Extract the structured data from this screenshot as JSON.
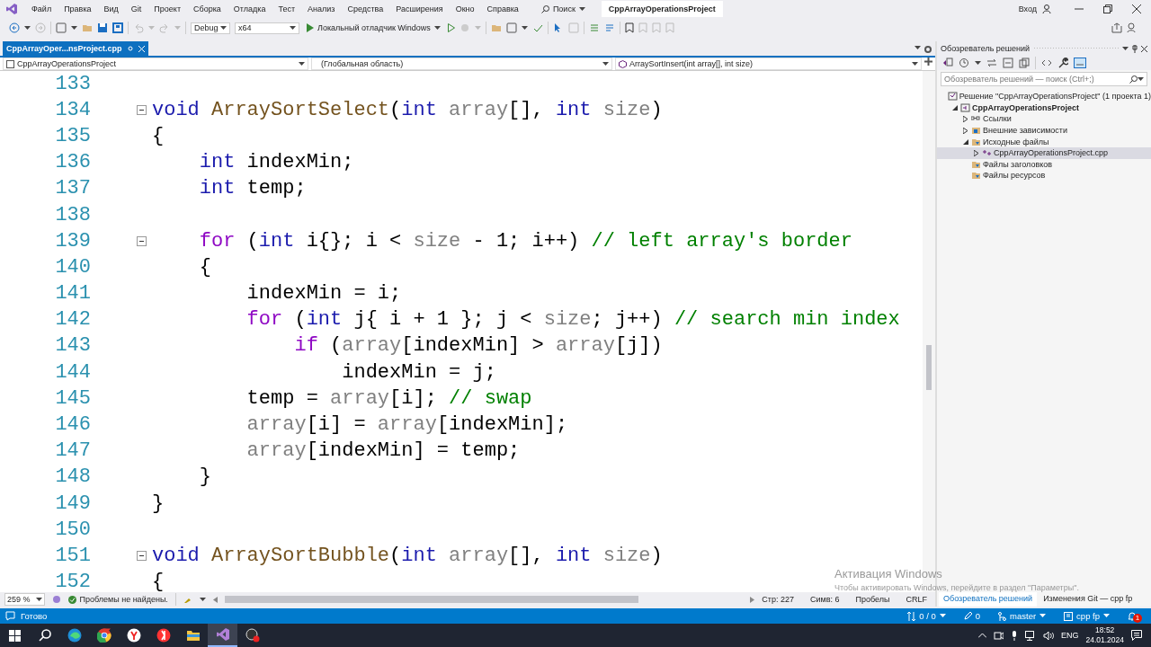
{
  "title_bar": {
    "menu": [
      "Файл",
      "Правка",
      "Вид",
      "Git",
      "Проект",
      "Сборка",
      "Отладка",
      "Тест",
      "Анализ",
      "Средства",
      "Расширения",
      "Окно",
      "Справка"
    ],
    "search": "Поиск",
    "solution_name": "CppArrayOperationsProject",
    "sign_in": "Вход"
  },
  "toolbar": {
    "configuration": "Debug",
    "platform": "x64",
    "run_target": "Локальный отладчик Windows"
  },
  "editor": {
    "tabs": [
      {
        "label": "CppArrayOper...nsProject.cpp",
        "selected": true
      }
    ],
    "nav": {
      "project": "CppArrayOperationsProject",
      "scope": "(Глобальная область)",
      "member": "ArraySortInsert(int array[], int size)"
    },
    "lines": [
      {
        "n": "133"
      },
      {
        "n": "134",
        "expanded": true,
        "spans": [
          {
            "text": "void ",
            "color": "#1b1bad"
          },
          {
            "text": "ArraySortSelect",
            "color": "#74531f"
          },
          {
            "text": "(",
            "color": "#000000"
          },
          {
            "text": "int ",
            "color": "#1b1bad"
          },
          {
            "text": "array",
            "color": "#808080"
          },
          {
            "text": "[], ",
            "color": "#000000"
          },
          {
            "text": "int ",
            "color": "#1b1bad"
          },
          {
            "text": "size",
            "color": "#808080"
          },
          {
            "text": ")",
            "color": "#000000"
          }
        ]
      },
      {
        "n": "135",
        "spans": [
          {
            "text": "{",
            "color": "#000000"
          }
        ]
      },
      {
        "n": "136",
        "spans": [
          {
            "text": "    int",
            "color": "#1b1bad"
          },
          {
            "text": " indexMin;",
            "color": "#000000"
          }
        ]
      },
      {
        "n": "137",
        "spans": [
          {
            "text": "    int",
            "color": "#1b1bad"
          },
          {
            "text": " temp;",
            "color": "#000000"
          }
        ]
      },
      {
        "n": "138"
      },
      {
        "n": "139",
        "expanded": true,
        "spans": [
          {
            "text": "    for",
            "color": "#8f08c4"
          },
          {
            "text": " (",
            "color": "#000000"
          },
          {
            "text": "int",
            "color": "#1b1bad"
          },
          {
            "text": " i{}; i < ",
            "color": "#000000"
          },
          {
            "text": "size",
            "color": "#808080"
          },
          {
            "text": " - 1; i++) ",
            "color": "#000000"
          },
          {
            "text": "// left array's border",
            "color": "#008000"
          }
        ]
      },
      {
        "n": "140",
        "spans": [
          {
            "text": "    {",
            "color": "#000000"
          }
        ]
      },
      {
        "n": "141",
        "spans": [
          {
            "text": "        indexMin = i;",
            "color": "#000000"
          }
        ]
      },
      {
        "n": "142",
        "spans": [
          {
            "text": "        for",
            "color": "#8f08c4"
          },
          {
            "text": " (",
            "color": "#000000"
          },
          {
            "text": "int",
            "color": "#1b1bad"
          },
          {
            "text": " j{ i + 1 }; j < ",
            "color": "#000000"
          },
          {
            "text": "size",
            "color": "#808080"
          },
          {
            "text": "; j++) ",
            "color": "#000000"
          },
          {
            "text": "// search min index",
            "color": "#008000"
          }
        ]
      },
      {
        "n": "143",
        "spans": [
          {
            "text": "            if",
            "color": "#8f08c4"
          },
          {
            "text": " (",
            "color": "#000000"
          },
          {
            "text": "array",
            "color": "#808080"
          },
          {
            "text": "[indexMin] > ",
            "color": "#000000"
          },
          {
            "text": "array",
            "color": "#808080"
          },
          {
            "text": "[j])",
            "color": "#000000"
          }
        ]
      },
      {
        "n": "144",
        "spans": [
          {
            "text": "                indexMin = j;",
            "color": "#000000"
          }
        ]
      },
      {
        "n": "145",
        "spans": [
          {
            "text": "        temp = ",
            "color": "#000000"
          },
          {
            "text": "array",
            "color": "#808080"
          },
          {
            "text": "[i]; ",
            "color": "#000000"
          },
          {
            "text": "// swap",
            "color": "#008000"
          }
        ]
      },
      {
        "n": "146",
        "spans": [
          {
            "text": "        array",
            "color": "#808080"
          },
          {
            "text": "[i] = ",
            "color": "#000000"
          },
          {
            "text": "array",
            "color": "#808080"
          },
          {
            "text": "[indexMin];",
            "color": "#000000"
          }
        ]
      },
      {
        "n": "147",
        "spans": [
          {
            "text": "        array",
            "color": "#808080"
          },
          {
            "text": "[indexMin] = temp;",
            "color": "#000000"
          }
        ]
      },
      {
        "n": "148",
        "spans": [
          {
            "text": "    }",
            "color": "#000000"
          }
        ]
      },
      {
        "n": "149",
        "spans": [
          {
            "text": "}",
            "color": "#000000"
          }
        ]
      },
      {
        "n": "150"
      },
      {
        "n": "151",
        "expanded": true,
        "spans": [
          {
            "text": "void ",
            "color": "#1b1bad"
          },
          {
            "text": "ArraySortBubble",
            "color": "#74531f"
          },
          {
            "text": "(",
            "color": "#000000"
          },
          {
            "text": "int ",
            "color": "#1b1bad"
          },
          {
            "text": "array",
            "color": "#808080"
          },
          {
            "text": "[], ",
            "color": "#000000"
          },
          {
            "text": "int ",
            "color": "#1b1bad"
          },
          {
            "text": "size",
            "color": "#808080"
          },
          {
            "text": ")",
            "color": "#000000"
          }
        ]
      },
      {
        "n": "152",
        "spans": [
          {
            "text": "{",
            "color": "#000000"
          }
        ]
      }
    ],
    "zoom": "259 %",
    "problems": "Проблемы не найдены.",
    "line": "Стр: 227",
    "column": "Симв: 6",
    "whitespace": "Пробелы",
    "line_ending": "CRLF"
  },
  "solution_explorer": {
    "title": "Обозреватель решений",
    "search": {
      "placeholder": "Обозреватель решений — поиск (Ctrl+;)"
    },
    "tree": [
      {
        "label": "Решение \"CppArrayOperationsProject\"  (1 проекта 1)",
        "kind": "solution",
        "selected": false,
        "children": [
          {
            "label": "CppArrayOperationsProject",
            "kind": "project",
            "expanded": true,
            "selected": false,
            "children": [
              {
                "label": "Ссылки",
                "kind": "references",
                "expanded": false,
                "selected": false
              },
              {
                "label": "Внешние зависимости",
                "kind": "dependencies",
                "expanded": false,
                "selected": false
              },
              {
                "label": "Исходные файлы",
                "kind": "filter",
                "expanded": true,
                "selected": false,
                "children": [
                  {
                    "label": "CppArrayOperationsProject.cpp",
                    "kind": "source",
                    "expanded": false,
                    "selected": true
                  }
                ]
              },
              {
                "label": "Файлы заголовков",
                "kind": "filter",
                "selected": false
              },
              {
                "label": "Файлы ресурсов",
                "kind": "filter",
                "selected": false
              }
            ]
          }
        ]
      }
    ],
    "tabs": [
      {
        "label": "Обозреватель решений",
        "selected": true
      },
      {
        "label": "Изменения Git — cpp fp",
        "selected": false
      }
    ]
  },
  "activation_notice": {
    "title": "Активация Windows",
    "text": "Чтобы активировать Windows, перейдите в раздел \"Параметры\"."
  },
  "status_bar": {
    "status": "Готово",
    "sync": "0 / 0",
    "pending": "0",
    "branch": "master",
    "repo": "cpp fp",
    "notifications": "1"
  },
  "taskbar": {
    "language": "ENG",
    "time": "18:52",
    "date": "24.01.2024"
  }
}
